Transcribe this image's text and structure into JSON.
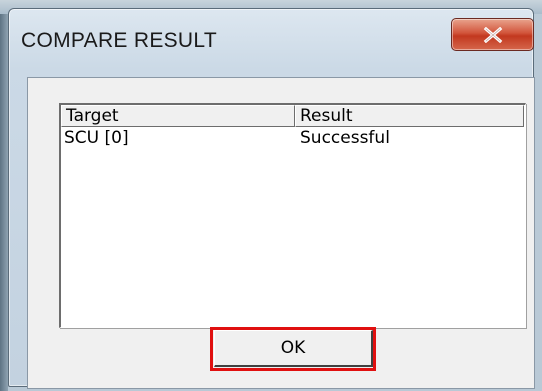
{
  "window": {
    "title": "COMPARE RESULT",
    "close_glyph": "X"
  },
  "table": {
    "columns": [
      "Target",
      "Result"
    ],
    "rows": [
      {
        "target": "SCU [0]",
        "result": "Successful"
      }
    ]
  },
  "buttons": {
    "ok_label": "OK"
  },
  "colors": {
    "highlight": "#e01010",
    "close_button": "#c2381f"
  },
  "icons": {
    "close": "close-icon"
  }
}
